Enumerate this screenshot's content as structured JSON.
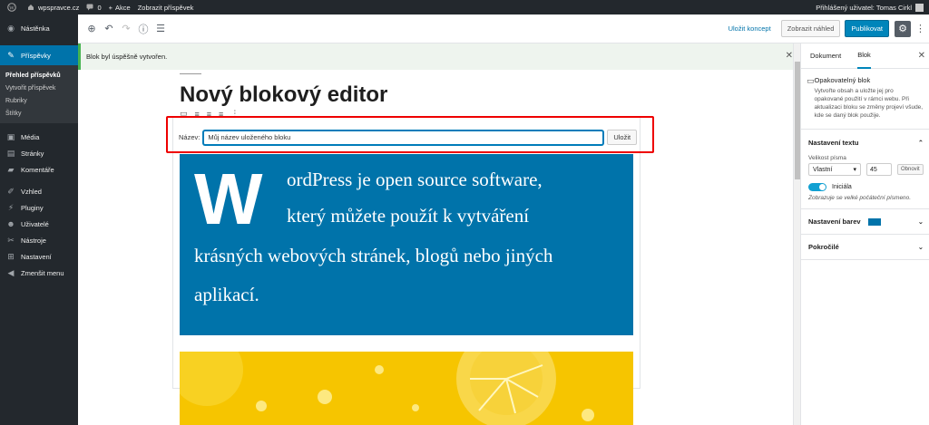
{
  "adminbar": {
    "site_name": "wpspravce.cz",
    "comments_count": "0",
    "new_label": "Akce",
    "view_post": "Zobrazit příspěvek",
    "user_text": "Přihlášený uživatel: Tomas Cirkl"
  },
  "sidebar": {
    "items": [
      {
        "label": "Nástěnka",
        "icon": "dashboard-icon"
      },
      {
        "label": "Příspěvky",
        "icon": "pin-icon"
      },
      {
        "label": "Média",
        "icon": "media-icon"
      },
      {
        "label": "Stránky",
        "icon": "pages-icon"
      },
      {
        "label": "Komentáře",
        "icon": "comments-icon"
      },
      {
        "label": "Vzhled",
        "icon": "appearance-icon"
      },
      {
        "label": "Pluginy",
        "icon": "plugins-icon"
      },
      {
        "label": "Uživatelé",
        "icon": "users-icon"
      },
      {
        "label": "Nástroje",
        "icon": "tools-icon"
      },
      {
        "label": "Nastavení",
        "icon": "settings-icon"
      },
      {
        "label": "Zmenšit menu",
        "icon": "collapse-icon"
      }
    ],
    "submenu": [
      "Přehled příspěvků",
      "Vytvořit příspěvek",
      "Rubriky",
      "Štítky"
    ]
  },
  "toolbar": {
    "save_draft": "Uložit koncept",
    "preview": "Zobrazit náhled",
    "publish": "Publikovat"
  },
  "notice": {
    "text": "Blok byl úspěšně vytvořen."
  },
  "editor": {
    "title": "Nový blokový editor",
    "name_label": "Název:",
    "name_value": "Můj název uloženého bloku",
    "save_button": "Uložit",
    "drop_cap": "W",
    "lines": [
      "ordPress je open source software,",
      "který můžete použít k vytváření",
      "krásných webových stránek, blogů nebo jiných",
      "aplikací."
    ]
  },
  "panel": {
    "tab_document": "Dokument",
    "tab_block": "Blok",
    "card_title": "Opakovatelný blok",
    "card_desc": "Vytvořte obsah a uložte jej pro opakované použití v rámci webu. Při aktualizaci bloku se změny projeví všude, kde se daný blok použije.",
    "text_settings": "Nastavení textu",
    "font_size_label": "Velikost písma",
    "font_size_select": "Vlastní",
    "font_size_value": "45",
    "reset": "Obnovit",
    "drop_cap_label": "Iniciála",
    "drop_cap_hint": "Zobrazuje se velké počáteční písmeno.",
    "color_settings": "Nastavení barev",
    "advanced": "Pokročilé"
  },
  "colors": {
    "accent": "#0073aa",
    "highlight": "#ee0000",
    "admin_dark": "#23282d"
  }
}
